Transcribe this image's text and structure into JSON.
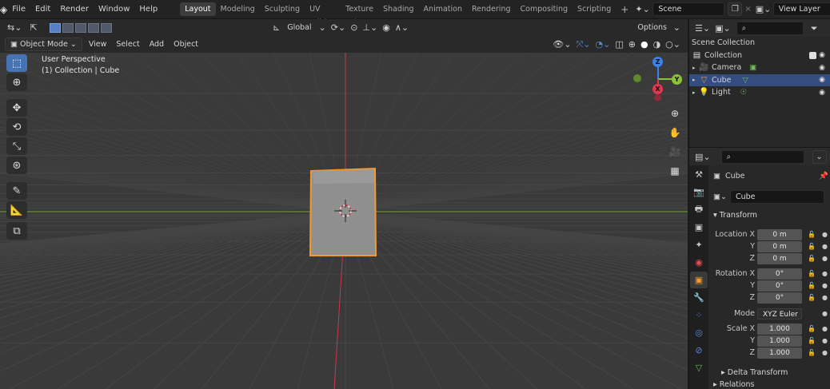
{
  "topbar": {
    "menus": [
      "File",
      "Edit",
      "Render",
      "Window",
      "Help"
    ],
    "workspaces": [
      "Layout",
      "Modeling",
      "Sculpting",
      "UV Editing",
      "Texture Paint",
      "Shading",
      "Animation",
      "Rendering",
      "Compositing",
      "Scripting"
    ],
    "active_workspace": "Layout",
    "add_workspace": "+",
    "scene": "Scene",
    "view_layer": "View Layer"
  },
  "viewport": {
    "transform_orientation": "Global",
    "options_label": "Options",
    "mode": "Object Mode",
    "menus": [
      "View",
      "Select",
      "Add",
      "Object"
    ],
    "info_line1": "User Perspective",
    "info_line2": "(1) Collection | Cube",
    "gizmo": {
      "x": "X",
      "y": "Y",
      "z": "Z"
    }
  },
  "toolbar": {
    "tools": [
      "select-box",
      "cursor",
      "move",
      "rotate",
      "scale",
      "transform",
      "annotate",
      "measure",
      "add-cube"
    ]
  },
  "outliner": {
    "title": "Scene Collection",
    "items": [
      {
        "label": "Collection",
        "icon": "collection-icon",
        "level": 0
      },
      {
        "label": "Camera",
        "icon": "camera-icon",
        "level": 1
      },
      {
        "label": "Cube",
        "icon": "mesh-icon",
        "level": 1,
        "selected": true
      },
      {
        "label": "Light",
        "icon": "light-icon",
        "level": 1
      }
    ]
  },
  "properties": {
    "object_name": "Cube",
    "data_name": "Cube",
    "transform_label": "Transform",
    "location": {
      "label": "Location X",
      "x": "0 m",
      "y": "0 m",
      "z": "0 m"
    },
    "rotation": {
      "label": "Rotation X",
      "x": "0°",
      "y": "0°",
      "z": "0°"
    },
    "mode_label": "Mode",
    "mode_value": "XYZ Euler",
    "scale": {
      "label": "Scale X",
      "x": "1.000",
      "y": "1.000",
      "z": "1.000"
    },
    "axis_y": "Y",
    "axis_z": "Z",
    "delta_transform": "Delta Transform",
    "relations": "Relations"
  },
  "colors": {
    "accent": "#4772b3",
    "selection_outline": "#f19a2e",
    "x_axis": "#e0394f",
    "y_axis": "#8bc23a",
    "z_axis": "#3a82e6"
  }
}
